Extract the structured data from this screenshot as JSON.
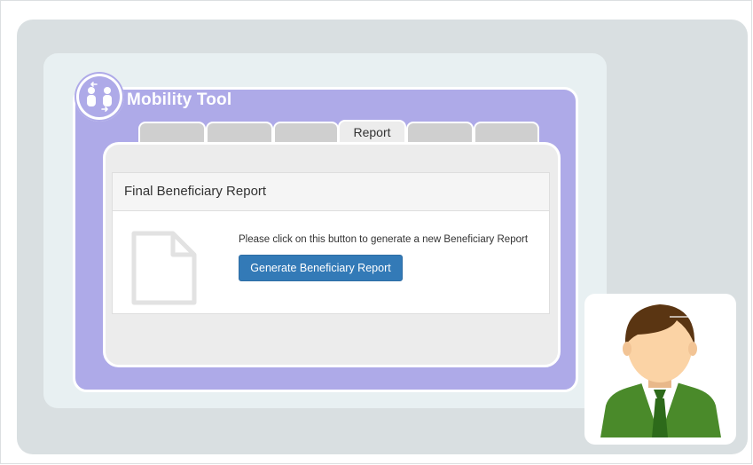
{
  "app": {
    "title": "Mobility Tool",
    "logo_icon": "people-exchange-icon"
  },
  "tabs": [
    {
      "label": "",
      "active": false
    },
    {
      "label": "",
      "active": false
    },
    {
      "label": "",
      "active": false
    },
    {
      "label": "Report",
      "active": true
    },
    {
      "label": "",
      "active": false
    },
    {
      "label": "",
      "active": false
    }
  ],
  "report": {
    "panel_title": "Final Beneficiary Report",
    "instruction": "Please click on this button to generate a new Beneficiary Report",
    "generate_button_label": "Generate Beneficiary Report",
    "document_icon": "document-icon"
  },
  "avatar": {
    "icon": "user-avatar-icon"
  },
  "colors": {
    "accent_purple": "#aeaae8",
    "button_blue": "#337ab7",
    "avatar_hair": "#5a3512",
    "avatar_jacket": "#4a8a2a",
    "avatar_skin": "#fbd3a5"
  }
}
